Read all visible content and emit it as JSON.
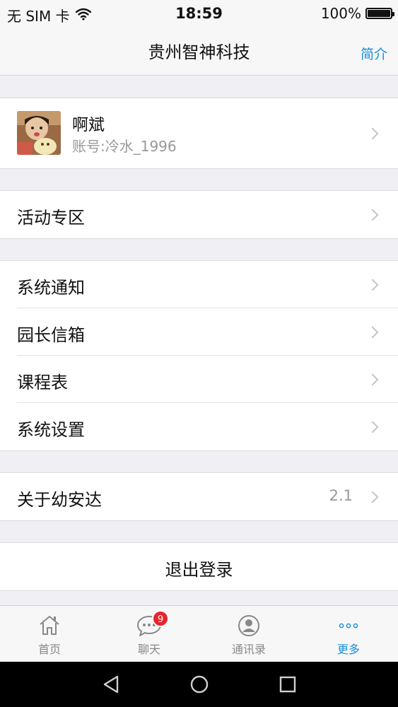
{
  "status_bar": {
    "carrier": "无 SIM 卡",
    "time": "18:59",
    "battery": "100%",
    "icons": [
      "wifi-icon",
      "battery-icon"
    ]
  },
  "nav": {
    "title": "贵州智神科技",
    "right_button": "简介"
  },
  "profile": {
    "name": "啊斌",
    "account": "账号:冷水_1996"
  },
  "menu": {
    "activity": "活动专区",
    "notice": "系统通知",
    "mailbox": "园长信箱",
    "schedule": "课程表",
    "settings": "系统设置",
    "about": "关于幼安达",
    "about_version": "2.1"
  },
  "logout_label": "退出登录",
  "tabs": {
    "home": "首页",
    "chat": "聊天",
    "chat_badge": "9",
    "contacts": "通讯录",
    "more": "更多"
  },
  "colors": {
    "accent": "#1a8ed8",
    "badge": "#e8242a",
    "background": "#efeff4"
  }
}
